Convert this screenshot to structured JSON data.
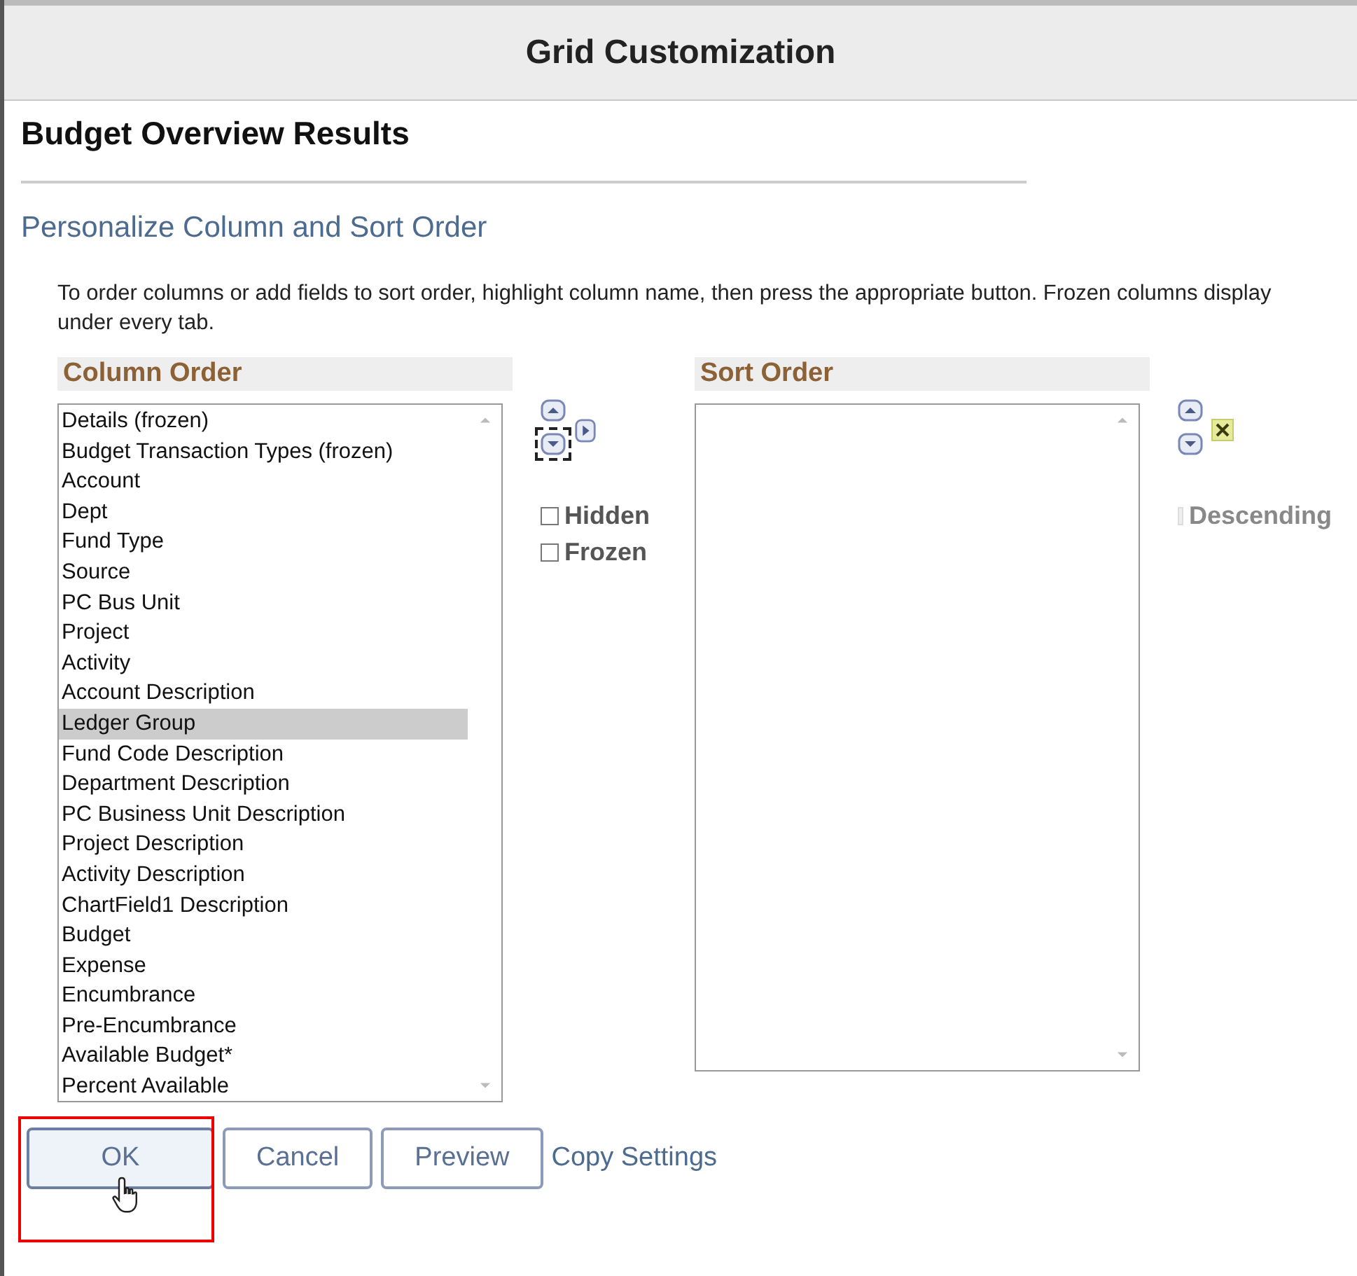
{
  "window": {
    "title": "Grid Customization"
  },
  "page_title": "Budget Overview Results",
  "section_title": "Personalize Column and Sort Order",
  "instructions": "To order columns or add fields to sort order, highlight column name, then press the appropriate button. Frozen columns display under every tab.",
  "column_order": {
    "heading": "Column Order",
    "items": [
      {
        "label": "Details (frozen)",
        "selected": false
      },
      {
        "label": "Budget Transaction Types (frozen)",
        "selected": false
      },
      {
        "label": "Account",
        "selected": false
      },
      {
        "label": "Dept",
        "selected": false
      },
      {
        "label": "Fund Type",
        "selected": false
      },
      {
        "label": "Source",
        "selected": false
      },
      {
        "label": "PC Bus Unit",
        "selected": false
      },
      {
        "label": "Project",
        "selected": false
      },
      {
        "label": "Activity",
        "selected": false
      },
      {
        "label": "Account Description",
        "selected": false
      },
      {
        "label": "Ledger Group",
        "selected": true
      },
      {
        "label": "Fund Code Description",
        "selected": false
      },
      {
        "label": "Department Description",
        "selected": false
      },
      {
        "label": "PC Business Unit Description",
        "selected": false
      },
      {
        "label": "Project Description",
        "selected": false
      },
      {
        "label": "Activity Description",
        "selected": false
      },
      {
        "label": "ChartField1 Description",
        "selected": false
      },
      {
        "label": "Budget",
        "selected": false
      },
      {
        "label": "Expense",
        "selected": false
      },
      {
        "label": "Encumbrance",
        "selected": false
      },
      {
        "label": "Pre-Encumbrance",
        "selected": false
      },
      {
        "label": "Available Budget*",
        "selected": false
      },
      {
        "label": "Percent Available",
        "selected": false
      }
    ]
  },
  "column_options": [
    {
      "label": "Hidden",
      "checked": false
    },
    {
      "label": "Frozen",
      "checked": false
    }
  ],
  "sort_order": {
    "heading": "Sort Order"
  },
  "sort_options": [
    {
      "label": "Descending",
      "checked": false,
      "disabled": true
    }
  ],
  "buttons": [
    {
      "label": "OK",
      "highlighted": true
    },
    {
      "label": "Cancel",
      "highlighted": false
    },
    {
      "label": "Preview",
      "highlighted": false
    }
  ],
  "link": "Copy Settings"
}
